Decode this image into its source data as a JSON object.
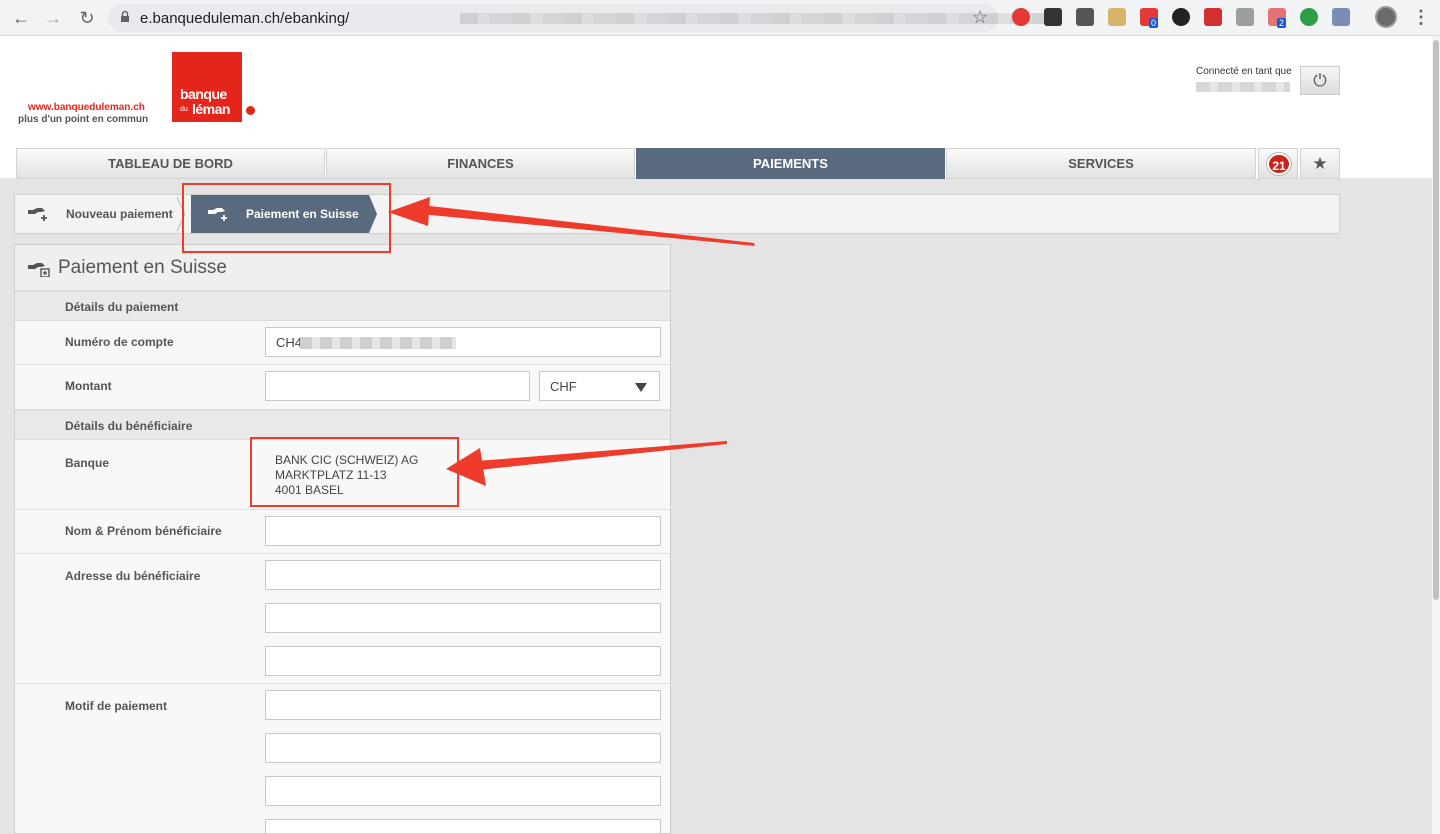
{
  "browser": {
    "url_text": "e.banqueduleman.ch/ebanking/",
    "extension_badges": [
      "0",
      "2"
    ]
  },
  "header": {
    "brand_url": "www.banqueduleman.ch",
    "brand_tagline": "plus d'un point en commun",
    "logo_line1": "banque",
    "logo_line2_small": "du",
    "logo_line3": "léman",
    "connected_label": "Connecté en tant que"
  },
  "tabs": [
    {
      "label": "TABLEAU DE BORD",
      "active": false
    },
    {
      "label": "FINANCES",
      "active": false
    },
    {
      "label": "PAIEMENTS",
      "active": true
    },
    {
      "label": "SERVICES",
      "active": false
    }
  ],
  "notifications_count": "21",
  "breadcrumb": {
    "item1": "Nouveau paiement",
    "item2": "Paiement en Suisse"
  },
  "form": {
    "title": "Paiement en Suisse",
    "section_payment": "Détails du paiement",
    "account_label": "Numéro de compte",
    "account_value_prefix": "CH4",
    "amount_label": "Montant",
    "currency_value": "CHF",
    "section_beneficiary": "Détails du bénéficiaire",
    "bank_label": "Banque",
    "bank_lines": [
      "BANK CIC (SCHWEIZ) AG",
      "MARKTPLATZ 11-13",
      "4001 BASEL"
    ],
    "name_label": "Nom & Prénom bénéficiaire",
    "address_label": "Adresse du bénéficiaire",
    "reason_label": "Motif de paiement"
  },
  "colors": {
    "brand_red": "#e3251c",
    "nav_active": "#5a6a7e",
    "annotation_red": "#ef3b2b"
  }
}
